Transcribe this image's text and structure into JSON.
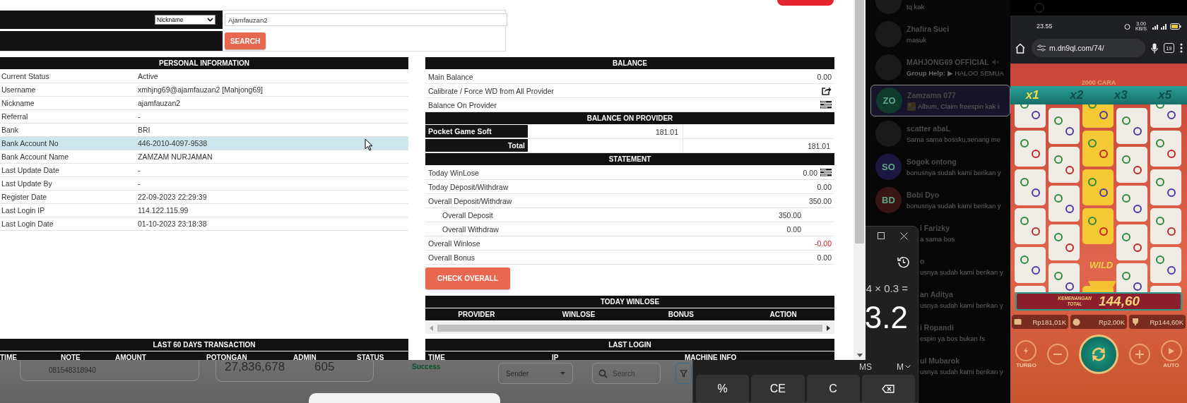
{
  "browser": {
    "search": {
      "field_select": "Nickname",
      "query": "Ajamfauzan2",
      "button": "SEARCH"
    },
    "personal_information": {
      "title": "PERSONAL INFORMATION",
      "rows": [
        {
          "label": "Current Status",
          "value": "Active",
          "hovered": false
        },
        {
          "label": "Username",
          "value": "xmhjng69@ajamfauzan2  [Mahjong69]",
          "hovered": false
        },
        {
          "label": "Nickname",
          "value": "ajamfauzan2",
          "hovered": false
        },
        {
          "label": "Referral",
          "value": "-",
          "hovered": false
        },
        {
          "label": "Bank",
          "value": "BRI",
          "hovered": false
        },
        {
          "label": "Bank Account No",
          "value": "446-2010-4097-9538",
          "hovered": true
        },
        {
          "label": "Bank Account Name",
          "value": "ZAMZAM NURJAMAN",
          "hovered": false
        },
        {
          "label": "Last Update Date",
          "value": "-",
          "hovered": false
        },
        {
          "label": "Last Update By",
          "value": "-",
          "hovered": false
        },
        {
          "label": "Register Date",
          "value": "22-09-2023 22:29:39",
          "hovered": false
        },
        {
          "label": "Last Login IP",
          "value": "114.122.115.99",
          "hovered": false
        },
        {
          "label": "Last Login Date",
          "value": "01-10-2023 23:18:38",
          "hovered": false
        }
      ]
    },
    "balance": {
      "title": "BALANCE",
      "rows": [
        {
          "label": "Main Balance",
          "value": "0.00",
          "kind": "value"
        },
        {
          "label": "Calibrate / Force WD from All Provider",
          "kind": "action"
        },
        {
          "label": "Balance On Provider",
          "kind": "list"
        }
      ]
    },
    "balance_on_provider": {
      "title": "BALANCE ON PROVIDER",
      "rows": [
        {
          "provider": "Pocket Game Soft",
          "amount": "181.01"
        }
      ],
      "total_label": "Total",
      "total": "181.01"
    },
    "statement": {
      "title": "STATEMENT",
      "rows": [
        {
          "label": "Today WinLose",
          "value": "0.00",
          "kind": "list",
          "negative": false
        },
        {
          "label": "Today Deposit/Withdraw",
          "value": "0.00",
          "kind": "plain",
          "negative": false
        },
        {
          "label": "Overall Deposit/Withdraw",
          "value": "350.00",
          "kind": "plain",
          "negative": false
        },
        {
          "label": "Overall Deposit",
          "value": "350.00",
          "kind": "sub",
          "negative": false
        },
        {
          "label": "Overall Withdraw",
          "value": "0.00",
          "kind": "sub",
          "negative": false
        },
        {
          "label": "Overall Winlose",
          "value": "-0.00",
          "kind": "plain",
          "negative": true
        },
        {
          "label": "Overall Bonus",
          "value": "0.00",
          "kind": "plain",
          "negative": false
        }
      ]
    },
    "check_button": "CHECK OVERALL",
    "today_winlose": {
      "title": "TODAY WINLOSE",
      "columns": [
        "PROVIDER",
        "WINLOSE",
        "BONUS",
        "ACTION"
      ]
    },
    "last_60_days": {
      "title": "LAST 60 DAYS TRANSACTION",
      "columns": [
        "TIME",
        "NOTE",
        "AMOUNT",
        "POTONGAN",
        "ADMIN",
        "STATUS"
      ]
    },
    "last_login": {
      "title": "LAST LOGIN",
      "columns": [
        "TIME",
        "IP",
        "MACHINE INFO"
      ]
    }
  },
  "background_app": {
    "phone_field": "081548318940",
    "amount": "27,836,678",
    "count": "605",
    "status": "Success",
    "sender_select": "Sender",
    "search_placeholder": "Search"
  },
  "calculator": {
    "expression": "4 × 0.3 =",
    "result": "3.2",
    "memory": [
      {
        "label": "MS",
        "kind": "text"
      },
      {
        "label": "M",
        "kind": "dropdown"
      }
    ],
    "keys": [
      {
        "label": "%",
        "kind": "text"
      },
      {
        "label": "CE",
        "kind": "text"
      },
      {
        "label": "C",
        "kind": "text"
      },
      {
        "kind": "backspace"
      }
    ]
  },
  "chat_list": [
    {
      "message": "tq kak",
      "kind": "photo",
      "selected": false
    },
    {
      "name": "Zhafira Suci",
      "message": "masuk",
      "kind": "photo",
      "selected": false
    },
    {
      "name": "MAHJONG69 OFFICIAL",
      "message": "**Group Help:** ▶ HALOO SEMUA",
      "kind": "photo",
      "selected": false,
      "muted": true
    },
    {
      "name": "Zamzamn 077",
      "message": "Album, Claim freespin kak i",
      "kind": "initials",
      "initials": "ZO",
      "color": "#0f3b2c",
      "selected": true,
      "attachment": true
    },
    {
      "name": "scatter abaL",
      "message": "Sama sama bossku,senang me",
      "kind": "photo",
      "selected": false
    },
    {
      "name": "Sogok ontong",
      "message": "bonusnya sudah kami berikan y",
      "kind": "initials",
      "initials": "SO",
      "color": "#1b1740",
      "selected": false
    },
    {
      "name": "Bobi Dyo",
      "message": "bonusnya sudah kami berikan y",
      "kind": "initials",
      "initials": "BD",
      "color": "#3a1515",
      "selected": false
    },
    {
      "name": "i Farizky",
      "message": "a sama bos",
      "kind": "covered",
      "selected": false
    },
    {
      "name": "o",
      "message": "usnya sudah kami berikan y",
      "kind": "covered",
      "selected": false
    },
    {
      "name": "an Aditya",
      "message": "usnya sudah kami berikan y",
      "kind": "covered",
      "selected": false
    },
    {
      "name": "i Ropandi",
      "message": "espin ya bos bukan fs",
      "kind": "covered",
      "selected": false
    },
    {
      "name": "ul Mubarok",
      "message": "usnya sudah kami berikan y",
      "kind": "covered",
      "selected": false
    }
  ],
  "phone": {
    "status_time": "23.55",
    "data_speed": "3.00 KB/S",
    "url": "m.dn9ql.com/74/",
    "tab_count": "19",
    "game": {
      "ways": "2000 CARA",
      "multipliers": [
        {
          "label": "x1",
          "selected": true
        },
        {
          "label": "x2",
          "selected": false
        },
        {
          "label": "x3",
          "selected": false
        },
        {
          "label": "x5",
          "selected": false
        }
      ],
      "wild": "WILD",
      "win_label": "KEMENANGAN TOTAL",
      "win_amount": "144,60",
      "balances": [
        {
          "amount": "Rp181,01K",
          "kind": "wallet"
        },
        {
          "amount": "Rp2,00K",
          "kind": "bet"
        },
        {
          "amount": "Rp144,60K",
          "kind": "win"
        }
      ],
      "turbo": "TURBO",
      "auto": "AUTO"
    }
  }
}
